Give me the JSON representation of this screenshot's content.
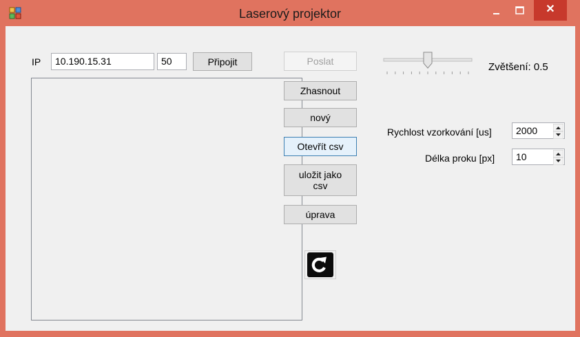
{
  "window": {
    "title": "Laserový projektor",
    "close_glyph": "✕",
    "colors": {
      "frame": "#e0735f",
      "close": "#c7392c"
    }
  },
  "connection": {
    "ip_label": "IP",
    "ip_value": "10.190.15.31",
    "port_value": "50",
    "connect_label": "Připojit"
  },
  "actions": {
    "send_label": "Poslat",
    "blank_label": "Zhasnout",
    "new_label": "nový",
    "open_csv_label": "Otevřít csv",
    "save_csv_label_line1": "uložit jako",
    "save_csv_label_line2": "csv",
    "edit_label": "úprava",
    "refresh_icon": "refresh-icon"
  },
  "zoom": {
    "label": "Zvětšení: 0.5",
    "slider_fraction": 0.5
  },
  "settings": {
    "sampling_label": "Rychlost vzorkování [us]",
    "sampling_value": "2000",
    "stroke_label": "Délka proku [px]",
    "stroke_value": "10"
  }
}
